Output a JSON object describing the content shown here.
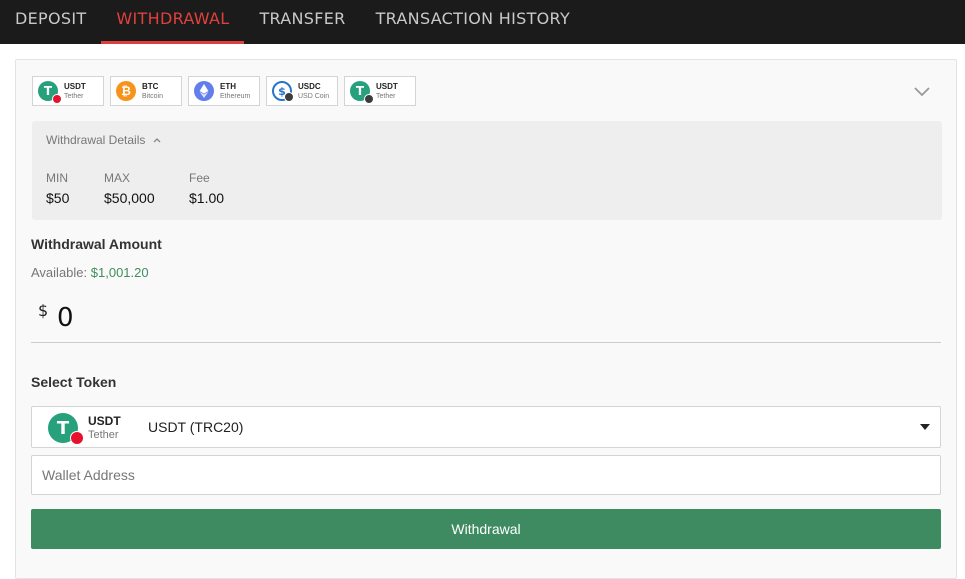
{
  "tabs": [
    {
      "label": "DEPOSIT",
      "active": false
    },
    {
      "label": "WITHDRAWAL",
      "active": true
    },
    {
      "label": "TRANSFER",
      "active": false
    },
    {
      "label": "TRANSACTION HISTORY",
      "active": false
    }
  ],
  "tokens": [
    {
      "symbol": "USDT",
      "name": "Tether",
      "icon": "usdt-tron-icon"
    },
    {
      "symbol": "BTC",
      "name": "Bitcoin",
      "icon": "btc-icon"
    },
    {
      "symbol": "ETH",
      "name": "Ethereum",
      "icon": "eth-icon"
    },
    {
      "symbol": "USDC",
      "name": "USD Coin",
      "icon": "usdc-icon"
    },
    {
      "symbol": "USDT",
      "name": "Tether",
      "icon": "usdt-eth-icon"
    }
  ],
  "details": {
    "title": "Withdrawal Details",
    "min_label": "MIN",
    "min_value": "$50",
    "max_label": "MAX",
    "max_value": "$50,000",
    "fee_label": "Fee",
    "fee_value": "$1.00"
  },
  "amount": {
    "title": "Withdrawal Amount",
    "available_label": "Available:",
    "available_value": "$1,001.20",
    "currency_symbol": "$",
    "value": "0"
  },
  "token_select": {
    "title": "Select Token",
    "symbol": "USDT",
    "name": "Tether",
    "selected": "USDT (TRC20)"
  },
  "wallet": {
    "placeholder": "Wallet Address"
  },
  "submit_label": "Withdrawal",
  "colors": {
    "accent": "#e0403d",
    "primary_button": "#3e8b61",
    "available_amount": "#3f8e5d"
  }
}
